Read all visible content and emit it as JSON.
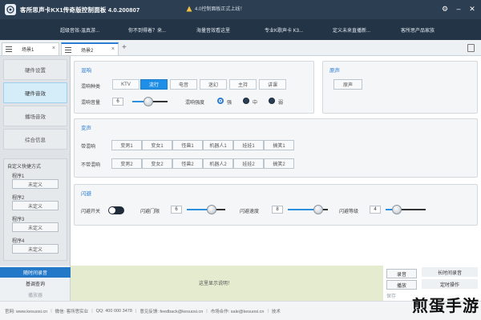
{
  "app": {
    "title": "客所思声卡KX1传奇版控制面板 4.0.200807",
    "notice": "4.0控制面板正式上线！"
  },
  "nav": [
    "超级音效-温真游...",
    "你不到得着？来...",
    "海量音效看这里",
    "专业K歌声卡 K3...",
    "定义未来直播新...",
    "客所思产品家族"
  ],
  "tabs": [
    {
      "label": "场景1",
      "active": false
    },
    {
      "label": "场景2",
      "active": true
    }
  ],
  "sidebar": {
    "items": [
      {
        "label": "硬件设置",
        "active": false
      },
      {
        "label": "硬件音效",
        "active": true
      },
      {
        "label": "播场音效",
        "active": false
      },
      {
        "label": "综合信息",
        "active": false
      }
    ],
    "custom_title": "自定义快捷方式",
    "programs": [
      {
        "label": "程序1",
        "button": "未定义"
      },
      {
        "label": "程序2",
        "button": "未定义"
      },
      {
        "label": "程序3",
        "button": "未定义"
      },
      {
        "label": "程序4",
        "button": "未定义"
      }
    ]
  },
  "reverb": {
    "title": "混响",
    "type_label": "混响种类",
    "types": [
      {
        "label": "KTV",
        "active": false
      },
      {
        "label": "流行",
        "active": true
      },
      {
        "label": "电音",
        "active": false
      },
      {
        "label": "迷幻",
        "active": false
      },
      {
        "label": "主持",
        "active": false
      },
      {
        "label": "讲课",
        "active": false
      }
    ],
    "volume_label": "混响音量",
    "volume_value": "6",
    "volume_level": 0.45,
    "intensity_label": "混响强度",
    "intensity_options": [
      {
        "label": "强",
        "checked": true
      },
      {
        "label": "中",
        "checked": false
      },
      {
        "label": "弱",
        "checked": false
      }
    ]
  },
  "original": {
    "title": "原声",
    "button": "原声"
  },
  "voice_change": {
    "title": "变声",
    "with_reverb_label": "带混响",
    "with_reverb": [
      "变男1",
      "变女1",
      "怪兽1",
      "机器人1",
      "娃娃1",
      "搞笑1"
    ],
    "without_reverb_label": "不带混响",
    "without_reverb": [
      "变男2",
      "变女2",
      "怪兽2",
      "机器人2",
      "娃娃2",
      "搞笑2"
    ]
  },
  "flash": {
    "title": "闪避",
    "switch_label": "闪避开关",
    "switch_on": false,
    "threshold_label": "闪避门限",
    "threshold_value": "6",
    "threshold_level": 0.7,
    "speed_label": "闪避速度",
    "speed_value": "8",
    "speed_level": 0.85,
    "level_label": "闪避等级",
    "level_value": "4",
    "level_level": 0.2
  },
  "bottom": {
    "left_items": [
      {
        "label": "随时间录音",
        "state": "active"
      },
      {
        "label": "基调查询",
        "state": "normal"
      },
      {
        "label": "播放器",
        "state": "dim"
      }
    ],
    "message": "这里显示说明！",
    "record_button": "录音",
    "play_button": "播放",
    "save_label": "保存",
    "long_record": "长时间录音",
    "timer": "定时操作"
  },
  "footer": {
    "website": "官网: www.kesuosi.cn",
    "weibo": "微信: 客所思实业",
    "qq": "QQ: 400 000 3478",
    "feedback": "意见反馈: feedback@kesuosi.cn",
    "market": "市场合作: sale@kesuosi.cn",
    "tech": "技术"
  },
  "watermark": "煎蛋手游"
}
